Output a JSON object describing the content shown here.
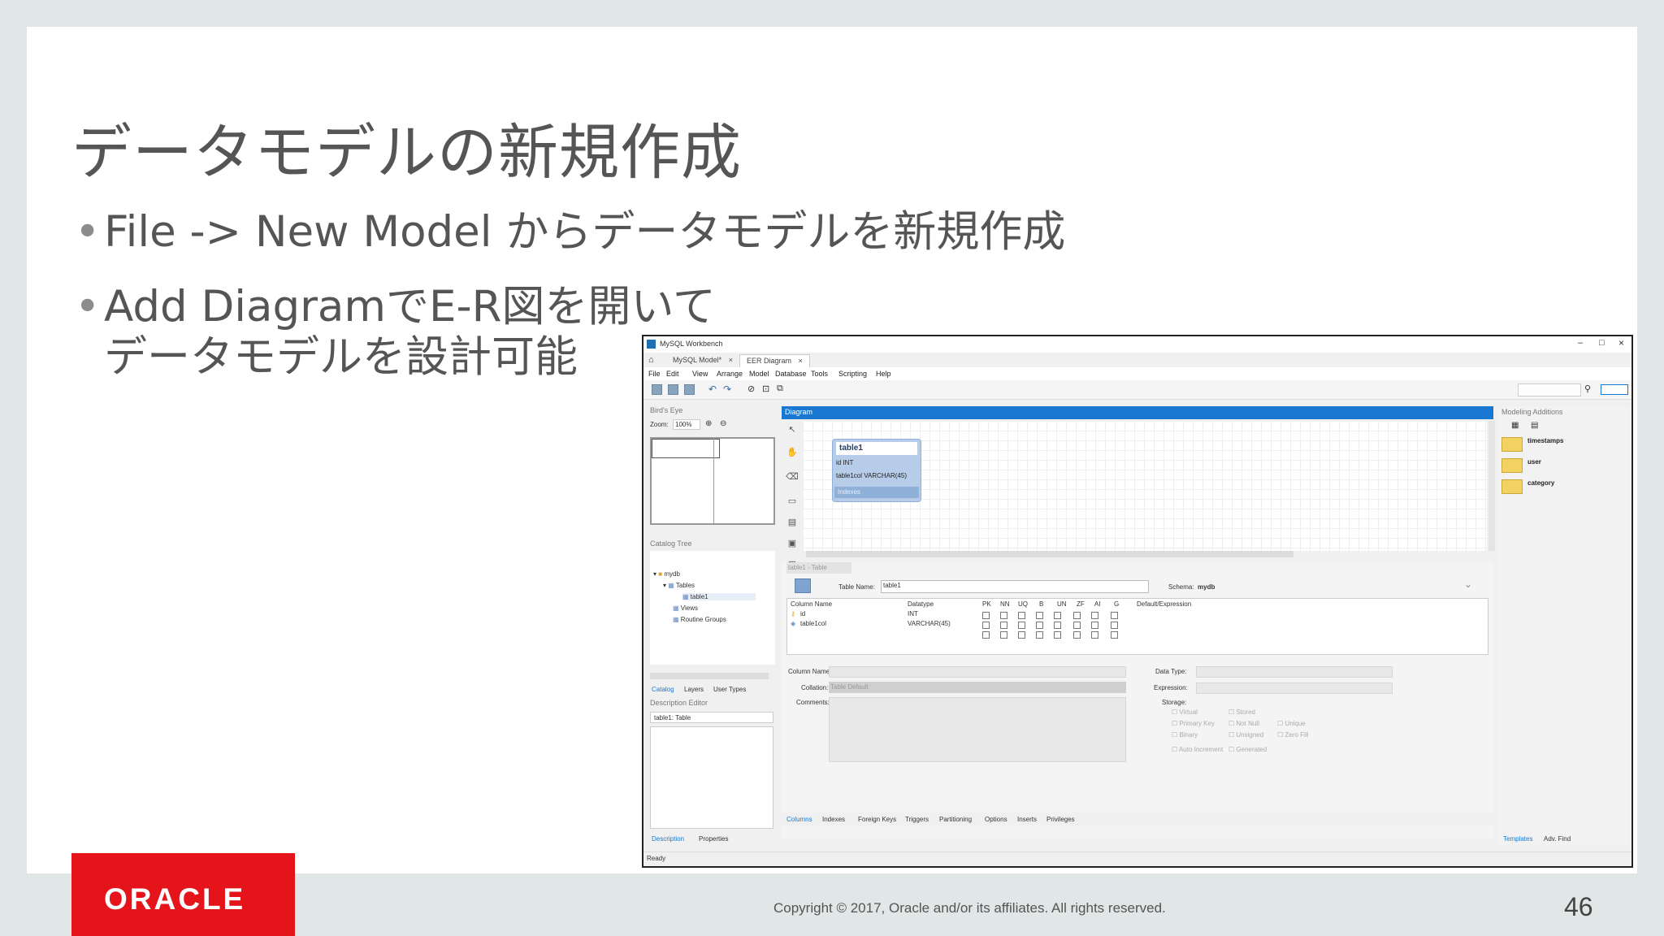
{
  "slide": {
    "title": "データモデルの新規作成",
    "bullets": [
      {
        "text": "File -> New Model からデータモデルを新規作成"
      },
      {
        "line1": "Add DiagramでE-R図を開いて",
        "line2": "データモデルを設計可能"
      }
    ],
    "bullet_char": "•",
    "logo_text": "ORACLE",
    "copyright": "Copyright © 2017, Oracle and/or its affiliates. All rights reserved.",
    "page_number": "46",
    "colors": {
      "oracle_red": "#e5141b",
      "diagram_header": "#1a77d2",
      "entity_fill": "#b6cce8"
    }
  },
  "workbench": {
    "app_title": "MySQL Workbench",
    "window_controls": {
      "minimize": "–",
      "maximize": "□",
      "close": "×"
    },
    "tabs": [
      {
        "label": "MySQL Model*",
        "close": "×"
      },
      {
        "label": "EER Diagram",
        "close": "×"
      }
    ],
    "menu": [
      "File",
      "Edit",
      "View",
      "Arrange",
      "Model",
      "Database",
      "Tools",
      "Scripting",
      "Help"
    ],
    "left": {
      "birds_eye": "Bird's Eye",
      "zoom_label": "Zoom:",
      "zoom_value": "100%",
      "catalog_tree": "Catalog Tree",
      "tree": {
        "schema": "mydb",
        "tables": "Tables",
        "table": "table1",
        "views": "Views",
        "routines": "Routine Groups"
      },
      "bottom_tabs": [
        "Catalog",
        "Layers",
        "User Types"
      ],
      "description_editor": "Description Editor",
      "description_select": "table1: Table",
      "footer_tabs": [
        "Description",
        "Properties"
      ]
    },
    "diagram": {
      "header": "Diagram",
      "entity": {
        "name": "table1",
        "columns": [
          "id INT",
          "table1col VARCHAR(45)"
        ],
        "indexes": "Indexes"
      }
    },
    "editor": {
      "tabs_top": [
        "table1 - Table"
      ],
      "table_name_label": "Table Name:",
      "table_name": "table1",
      "schema_label": "Schema:",
      "schema": "mydb",
      "columns_headers": [
        "Column Name",
        "Datatype",
        "PK",
        "NN",
        "UQ",
        "B",
        "UN",
        "ZF",
        "AI",
        "G",
        "Default/Expression"
      ],
      "rows": [
        {
          "name": "id",
          "type": "INT"
        },
        {
          "name": "table1col",
          "type": "VARCHAR(45)"
        }
      ],
      "column_name_label": "Column Name:",
      "collation_label": "Collation:",
      "collation_value": "Table Default",
      "comments_label": "Comments:",
      "data_type_label": "Data Type:",
      "expression_label": "Expression:",
      "storage_label": "Storage:",
      "storage_options": [
        "Virtual",
        "Stored",
        "Primary Key",
        "Not Null",
        "Unique",
        "Binary",
        "Unsigned",
        "Zero Fill",
        "Auto Increment",
        "Generated"
      ],
      "bottom_tabs": [
        "Columns",
        "Indexes",
        "Foreign Keys",
        "Triggers",
        "Partitioning",
        "Options",
        "Inserts",
        "Privileges"
      ]
    },
    "right": {
      "header": "Modeling Additions",
      "snippets": [
        "timestamps",
        "user",
        "category"
      ],
      "bottom_tabs": [
        "Templates",
        "Adv. Find"
      ]
    },
    "status": "Ready"
  }
}
